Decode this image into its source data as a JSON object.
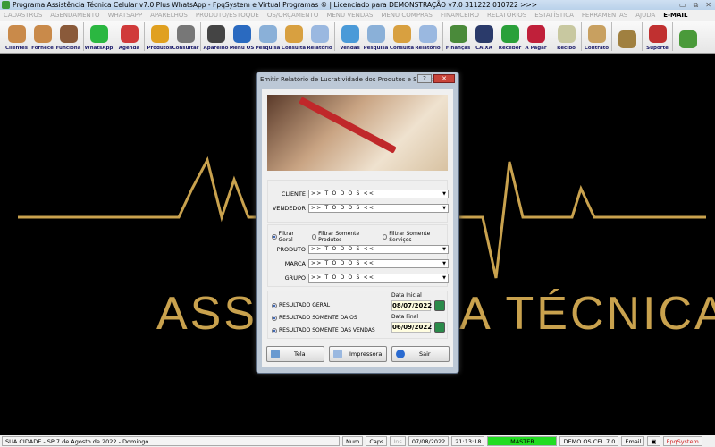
{
  "window": {
    "title": "Programa Assistência Técnica Celular v7.0 Plus WhatsApp - FpqSystem e Virtual Programas ® | Licenciado para  DEMONSTRAÇÃO v7.0 311222 010722 >>>",
    "buttons": [
      "▭",
      "⧉",
      "✕"
    ]
  },
  "menu": [
    "CADASTROS",
    "AGENDAMENTO",
    "WHATSAPP",
    "APARELHOS",
    "PRODUTO/ESTOQUE",
    "OS/ORÇAMENTO",
    "MENU VENDAS",
    "MENU COMPRAS",
    "FINANCEIRO",
    "RELATÓRIOS",
    "ESTATÍSTICA",
    "FERRAMENTAS",
    "AJUDA",
    "E-MAIL"
  ],
  "toolbar": [
    {
      "label": "Clientes",
      "icon": "clients-icon",
      "color": "#c98a4a"
    },
    {
      "label": "Fornece",
      "icon": "supplier-icon",
      "color": "#c98a4a"
    },
    {
      "label": "Funciona",
      "icon": "employee-icon",
      "color": "#8a5a3a",
      "sep": true
    },
    {
      "label": "WhatsApp",
      "icon": "whatsapp-icon",
      "color": "#2bb741",
      "sep": true
    },
    {
      "label": "Agenda",
      "icon": "calendar-icon",
      "color": "#d03a3a",
      "sep": true
    },
    {
      "label": "Produtos",
      "icon": "products-icon",
      "color": "#e0a020"
    },
    {
      "label": "Consultar",
      "icon": "barcode-icon",
      "color": "#777",
      "sep": true
    },
    {
      "label": "Aparelho",
      "icon": "device-icon",
      "color": "#444"
    },
    {
      "label": "Menu OS",
      "icon": "phone-repair-icon",
      "color": "#2a6ac0"
    },
    {
      "label": "Pesquisa",
      "icon": "search-icon",
      "color": "#8ab0d8"
    },
    {
      "label": "Consulta",
      "icon": "drawer-icon",
      "color": "#d8a040"
    },
    {
      "label": "Relatório",
      "icon": "printer-icon",
      "color": "#9ab8e0",
      "sep": true
    },
    {
      "label": "Vendas",
      "icon": "monitor-icon",
      "color": "#4a9ad8"
    },
    {
      "label": "Pesquisa",
      "icon": "search-icon",
      "color": "#8ab0d8"
    },
    {
      "label": "Consulta",
      "icon": "drawer-icon",
      "color": "#d8a040"
    },
    {
      "label": "Relatório",
      "icon": "printer-icon",
      "color": "#9ab8e0",
      "sep": true
    },
    {
      "label": "Finanças",
      "icon": "finance-chart-icon",
      "color": "#4a8a3a"
    },
    {
      "label": "CAIXA",
      "icon": "cashbook-icon",
      "color": "#2a3a6a"
    },
    {
      "label": "Recebor",
      "icon": "dollar-green-icon",
      "color": "#2aa03a"
    },
    {
      "label": "A Pagar",
      "icon": "dollar-red-icon",
      "color": "#c0203a",
      "sep": true
    },
    {
      "label": "Recibo",
      "icon": "receipt-icon",
      "color": "#c8c8a0",
      "sep": true
    },
    {
      "label": "Contrato",
      "icon": "contract-scroll-icon",
      "color": "#c8a060",
      "sep": true
    },
    {
      "label": "",
      "icon": "coins-icon",
      "color": "#a08040",
      "sep": true
    },
    {
      "label": "Suporte",
      "icon": "support-icon",
      "color": "#c03030",
      "sep": true
    },
    {
      "label": "",
      "icon": "exit-icon",
      "color": "#4a9a3a"
    }
  ],
  "background": {
    "text": "ASSISTÊNCIA TÉCNICA"
  },
  "dialog": {
    "title": "Emitir Relatório de Lucratividade dos Produtos e Serviços",
    "help": "?",
    "close": "✕",
    "cliente": {
      "label": "CLIENTE",
      "value": ">> T O D O S <<"
    },
    "vendedor": {
      "label": "VENDEDOR",
      "value": ">> T O D O S <<"
    },
    "filters": [
      {
        "label": "Filtrar Geral",
        "checked": true
      },
      {
        "label": "Filtrar Somente Produtos",
        "checked": false
      },
      {
        "label": "Filtrar Somente Serviços",
        "checked": false
      }
    ],
    "produto": {
      "label": "PRODUTO",
      "value": ">> T O D O S <<"
    },
    "marca": {
      "label": "MARCA",
      "value": ">> T O D O S <<"
    },
    "grupo": {
      "label": "GRUPO",
      "value": ">> T O D O S <<"
    },
    "results": [
      {
        "label": "RESULTADO GERAL"
      },
      {
        "label": "RESULTADO SOMENTE DA OS"
      },
      {
        "label": "RESULTADO SOMENTE DAS VENDAS"
      }
    ],
    "data_inicial": {
      "label": "Data Inicial",
      "value": "08/07/2022"
    },
    "data_final": {
      "label": "Data Final",
      "value": "06/09/2022"
    },
    "buttons": {
      "tela": "Tela",
      "impressora": "Impressora",
      "sair": "Sair"
    }
  },
  "status": {
    "city": "SUA CIDADE - SP  7 de Agosto de 2022 - Domingo",
    "num": "Num",
    "caps": "Caps",
    "ins": "Ins",
    "date": "07/08/2022",
    "time": "21:13:18",
    "user": "MASTER",
    "user_color": "#22dd22",
    "db": "DEMO OS CEL 7.0",
    "email": "Email",
    "brand": "FpqSystem"
  }
}
